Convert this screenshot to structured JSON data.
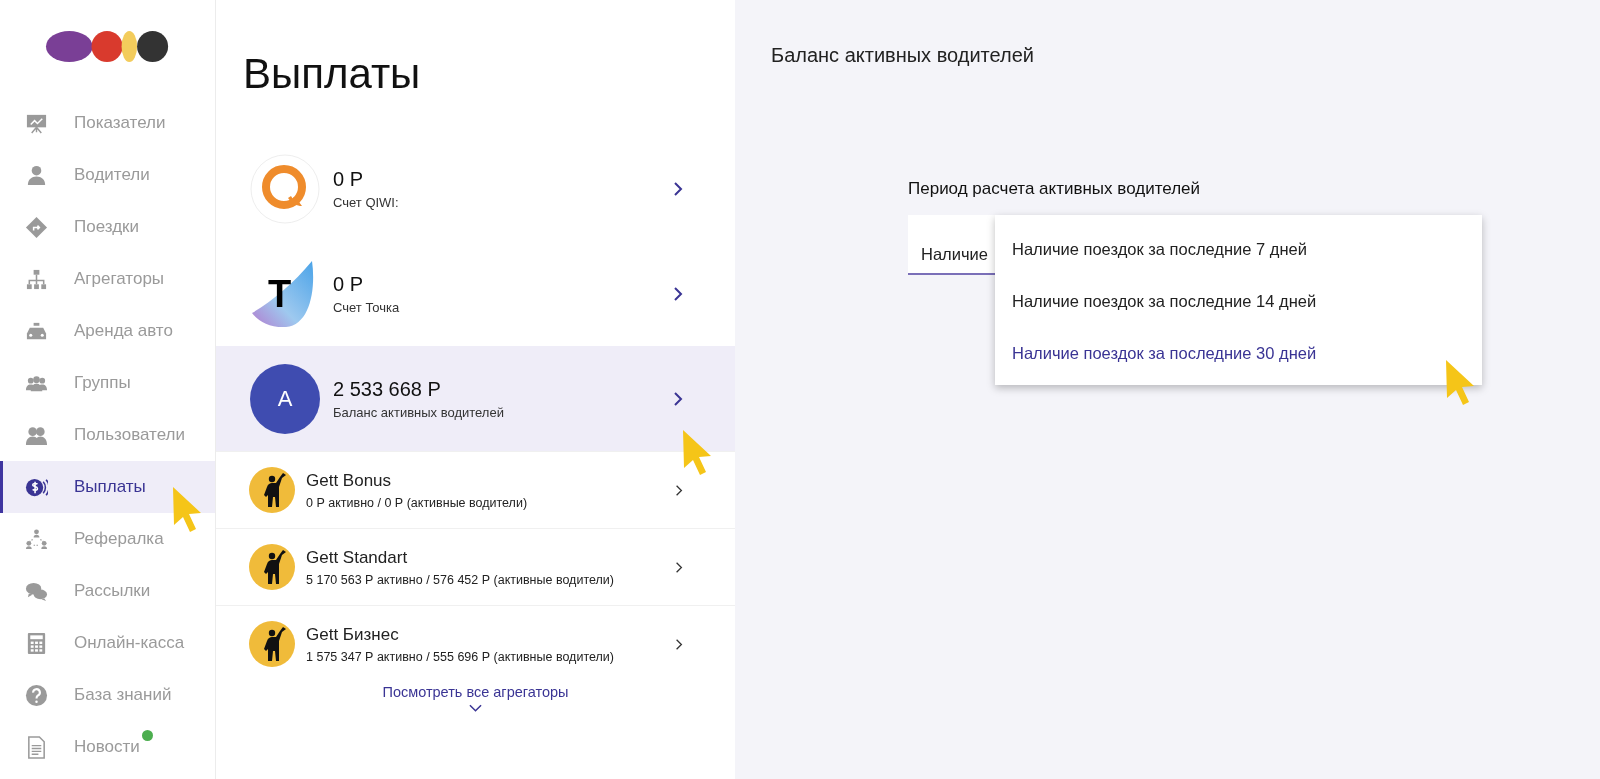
{
  "sidebar": {
    "items": [
      {
        "label": "Показатели",
        "selected": false,
        "unread": false
      },
      {
        "label": "Водители",
        "selected": false,
        "unread": false
      },
      {
        "label": "Поездки",
        "selected": false,
        "unread": false
      },
      {
        "label": "Агрегаторы",
        "selected": false,
        "unread": false
      },
      {
        "label": "Аренда авто",
        "selected": false,
        "unread": false
      },
      {
        "label": "Группы",
        "selected": false,
        "unread": false
      },
      {
        "label": "Пользователи",
        "selected": false,
        "unread": false
      },
      {
        "label": "Выплаты",
        "selected": true,
        "unread": false
      },
      {
        "label": "Рефералка",
        "selected": false,
        "unread": false
      },
      {
        "label": "Рассылки",
        "selected": false,
        "unread": false
      },
      {
        "label": "Онлайн-касса",
        "selected": false,
        "unread": false
      },
      {
        "label": "База знаний",
        "selected": false,
        "unread": false
      },
      {
        "label": "Новости",
        "selected": false,
        "unread": true
      }
    ]
  },
  "page_title": "Выплаты",
  "accounts": [
    {
      "kind": "qiwi",
      "amount": "0 Р",
      "caption": "Счет QIWI:",
      "selected": false
    },
    {
      "kind": "tochka",
      "logo_text": "T",
      "amount": "0 Р",
      "caption": "Счет Точка",
      "selected": false
    },
    {
      "kind": "letter",
      "logo_text": "A",
      "amount": "2 533 668 Р",
      "caption": "Баланс активных водителей",
      "selected": true
    }
  ],
  "aggregators": [
    {
      "name": "Gett Bonus",
      "summary": "0 Р активно / 0 Р (активные водители)"
    },
    {
      "name": "Gett Standart",
      "summary": "5 170 563 Р активно / 576 452 Р (активные водители)"
    },
    {
      "name": "Gett Бизнес",
      "summary": "1 575 347 Р активно / 555 696 Р (активные водители)"
    }
  ],
  "show_all_link": "Посмотреть все агрегаторы",
  "detail": {
    "title": "Баланс активных водителей",
    "field_label": "Период расчета активных водителей",
    "value": "Наличие",
    "open": true,
    "options": [
      {
        "label": "Наличие поездок за последние 7 дней",
        "selected": false
      },
      {
        "label": "Наличие поездок за последние 14 дней",
        "selected": false
      },
      {
        "label": "Наличие поездок за последние 30 дней",
        "selected": true
      }
    ]
  }
}
